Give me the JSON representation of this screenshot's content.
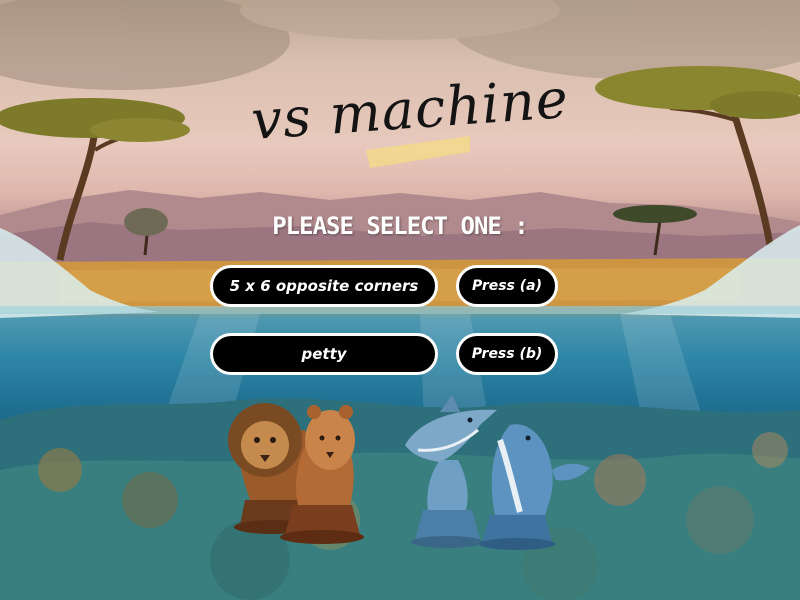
{
  "title": "vs machine",
  "prompt": "PLEASE SELECT ONE :",
  "options": [
    {
      "label": "5 x 6 opposite corners",
      "key_label": "Press (a)"
    },
    {
      "label": "petty",
      "key_label": "Press (b)"
    }
  ],
  "pieces": {
    "left_team": [
      "lion-icon",
      "lioness-icon"
    ],
    "right_team": [
      "shark-icon",
      "whale-icon"
    ]
  },
  "colors": {
    "button_bg": "#000000",
    "button_border": "#ffffff",
    "text": "#ffffff",
    "title_highlight": "#f2d98a"
  }
}
